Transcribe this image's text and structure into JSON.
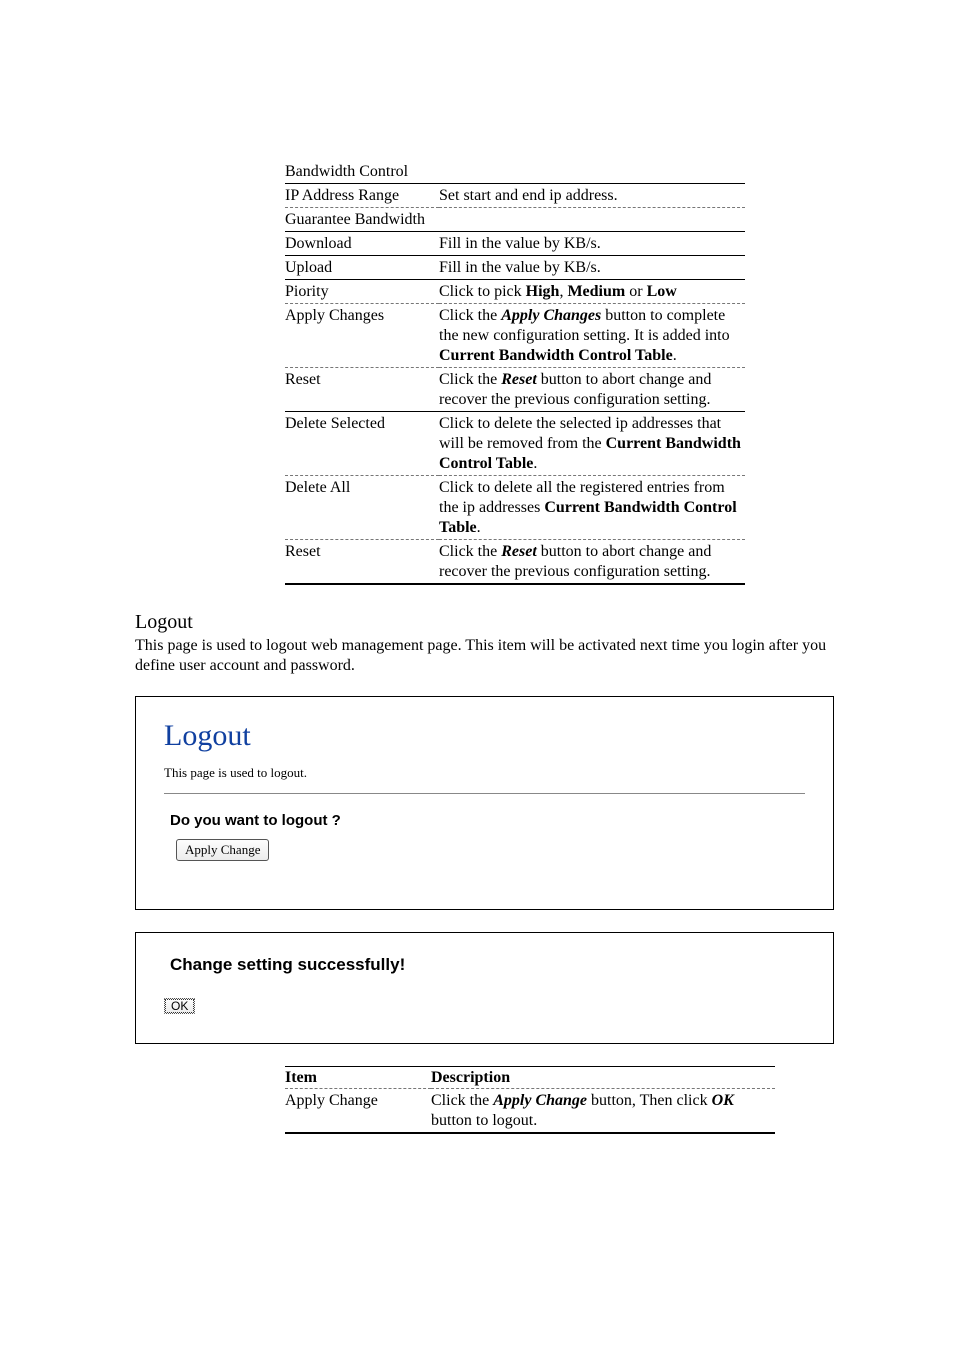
{
  "bandwidth_table": {
    "rows": [
      {
        "label": "Bandwidth Control",
        "desc": "",
        "style": "solid",
        "colspan": true
      },
      {
        "label": "IP Address Range",
        "desc": "Set start and end ip address.",
        "style": "dashed"
      },
      {
        "label": "Guarantee Bandwidth",
        "desc": "",
        "style": "solid",
        "colspan": true
      },
      {
        "label": "Download",
        "desc": "Fill in the value by KB/s.",
        "style": "solid"
      },
      {
        "label": "Upload",
        "desc": "Fill in the value by KB/s.",
        "style": "solid"
      },
      {
        "label": "Piority",
        "desc_html": "Click to pick <b>High</b>, <b>Medium</b> or <b>Low</b>",
        "style": "dashed"
      },
      {
        "label": "Apply Changes",
        "desc_html": "Click the <b><i>Apply Changes</i></b> button to complete the new configuration setting. It is added into <b>Current Bandwidth Control Table</b>.",
        "style": "dashed"
      },
      {
        "label": "Reset",
        "desc_html": "Click the <b><i>Reset</i></b> button to abort change and recover the previous configuration setting.",
        "style": "solid"
      },
      {
        "label": "Delete Selected",
        "desc_html": "Click to delete the selected ip addresses that will be removed from the <b>Current Bandwidth Control Table</b>.",
        "style": "dashed"
      },
      {
        "label": "Delete All",
        "desc_html": "Click to delete all the registered entries from the ip addresses <b>Current Bandwidth Control Table</b>.",
        "style": "dashed"
      },
      {
        "label": "Reset",
        "desc_html": "Click the <b><i>Reset</i></b> button to abort change and recover the previous configuration setting.",
        "style": "thick"
      }
    ]
  },
  "logout": {
    "title": "Logout",
    "desc": "This page is used to logout web management page. This item will be activated next time you login after you define user account and password.",
    "box": {
      "heading": "Logout",
      "subtext": "This page is used to logout.",
      "question": "Do you want to logout ?",
      "apply_btn": "Apply Change"
    },
    "success": {
      "text": "Change setting successfully!",
      "ok_btn": "OK"
    }
  },
  "table2": {
    "head_item": "Item",
    "head_desc": "Description",
    "row_label": "Apply Change",
    "row_desc_html": "Click the <b><i>Apply Change</i></b> button, Then click <b><i>OK</i></b> button to logout."
  }
}
